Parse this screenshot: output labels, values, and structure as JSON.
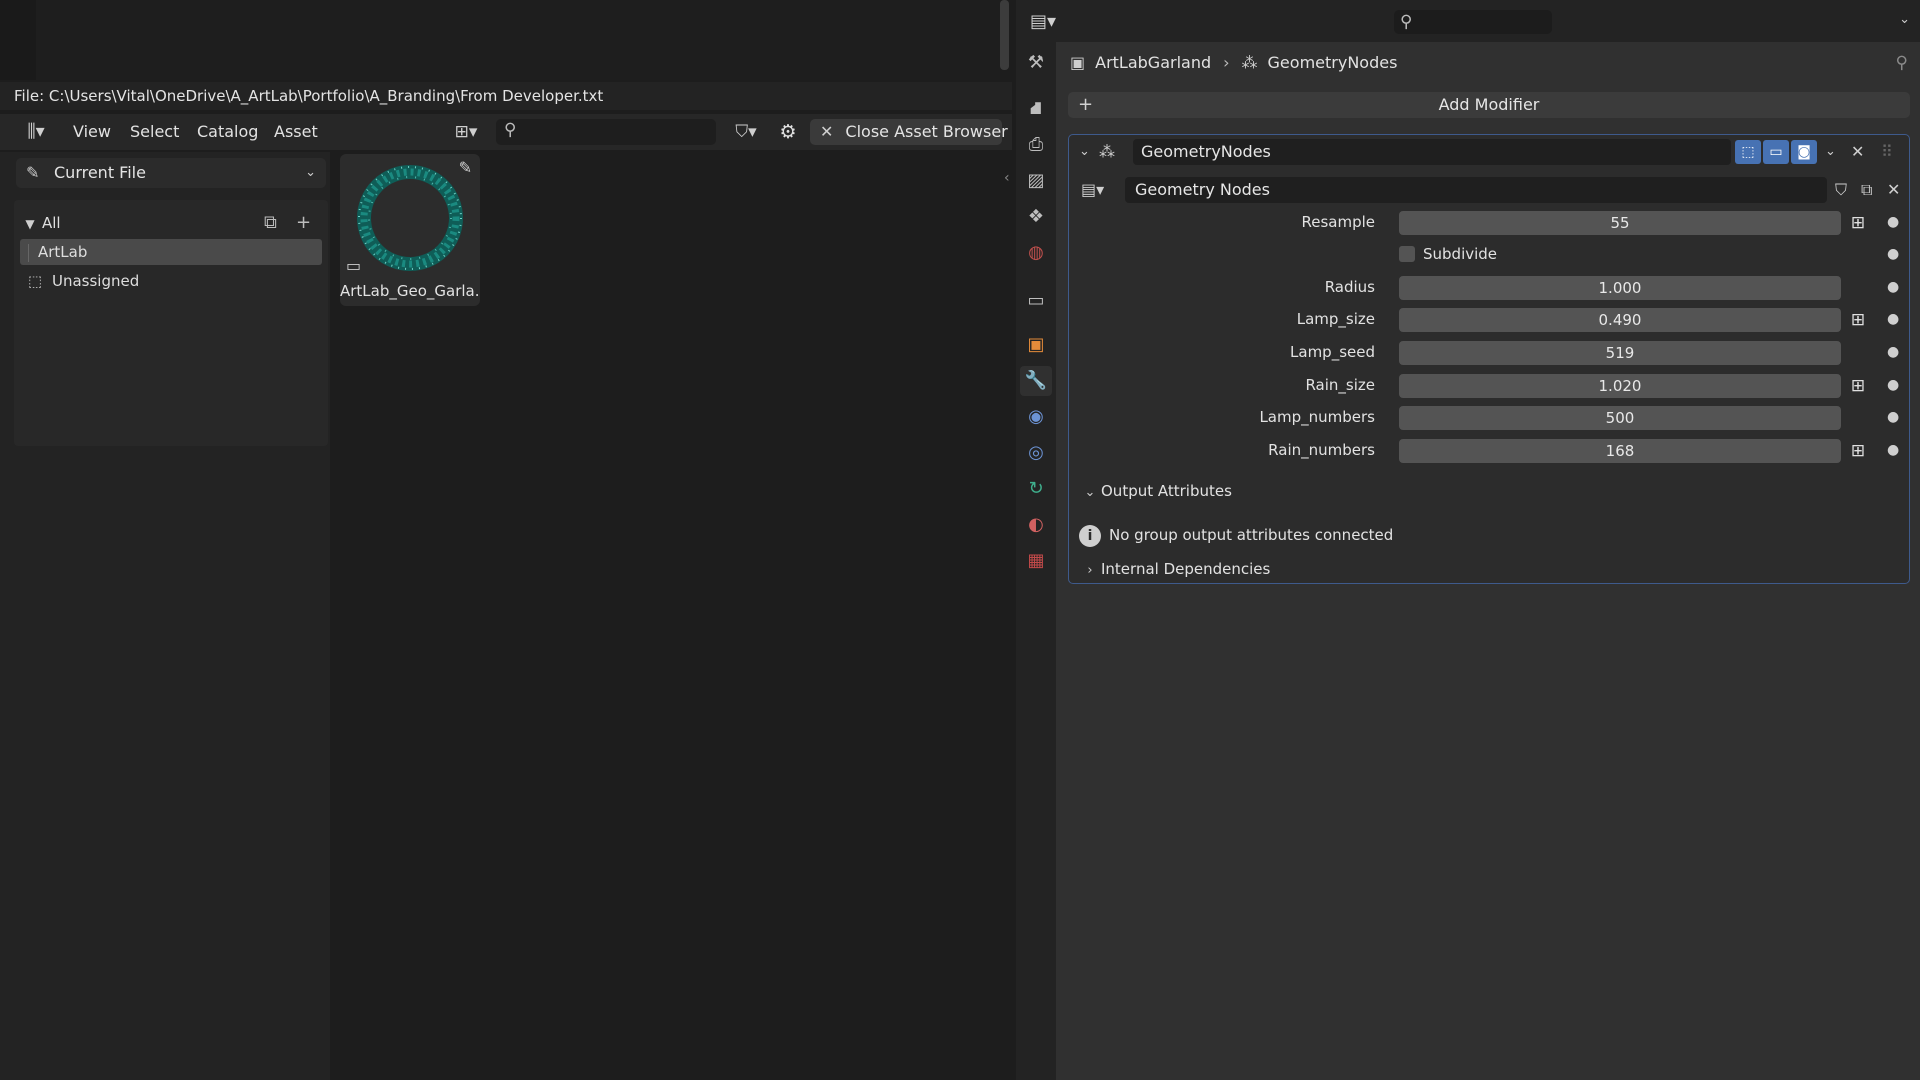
{
  "file_path": "File: C:\\Users\\Vital\\OneDrive\\A_ArtLab\\Portfolio\\A_Branding\\From Developer.txt",
  "asset_browser": {
    "menu": [
      "View",
      "Select",
      "Catalog",
      "Asset"
    ],
    "close_button": "Close Asset Browser",
    "library": "Current File",
    "catalogs": {
      "root": "All",
      "items": [
        "ArtLab",
        "Unassigned"
      ],
      "selected": "ArtLab"
    },
    "assets": [
      {
        "name": "ArtLab_Geo_Garla..."
      }
    ]
  },
  "properties": {
    "breadcrumb": {
      "object": "ArtLabGarland",
      "modifier": "GeometryNodes"
    },
    "add_modifier": "Add Modifier",
    "modifier": {
      "name": "GeometryNodes",
      "node_group": "Geometry Nodes",
      "inputs": [
        {
          "label": "Resample",
          "value": "55"
        },
        {
          "label": "Subdivide",
          "checked": false
        },
        {
          "label": "Radius",
          "value": "1.000"
        },
        {
          "label": "Lamp_size",
          "value": "0.490"
        },
        {
          "label": "Lamp_seed",
          "value": "519"
        },
        {
          "label": "Rain_size",
          "value": "1.020"
        },
        {
          "label": "Lamp_numbers",
          "value": "500"
        },
        {
          "label": "Rain_numbers",
          "value": "168"
        }
      ],
      "output_attributes": {
        "title": "Output Attributes",
        "message": "No group output attributes connected"
      },
      "internal_dependencies": "Internal Dependencies"
    }
  },
  "colors": {
    "accent": "#4772b3",
    "active_tab": "#5d8ad9",
    "garland": "#1a8a80"
  }
}
